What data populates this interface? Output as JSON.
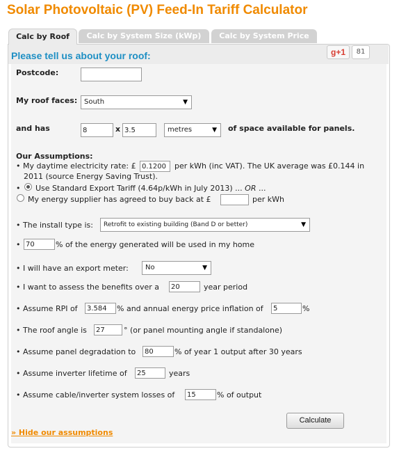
{
  "page": {
    "title": "Solar Photovoltaic (PV) Feed-In Tariff Calculator"
  },
  "tabs": [
    {
      "label": "Calc by Roof",
      "active": true
    },
    {
      "label": "Calc by System Size (kWp)",
      "active": false
    },
    {
      "label": "Calc by System Price",
      "active": false
    }
  ],
  "panel": {
    "heading": "Please tell us about your roof:"
  },
  "social": {
    "gplus_label": "g+1",
    "gplus_count": "81"
  },
  "roof": {
    "postcode_label": "Postcode:",
    "postcode_value": "",
    "faces_label": "My roof faces:",
    "faces_value": "South",
    "and_has_label": "and has",
    "dim_a": "8",
    "times": "x",
    "dim_b": "3.5",
    "unit_value": "metres",
    "space_suffix": "of space available for panels."
  },
  "assumptions": {
    "heading": "Our Assumptions:",
    "daytime_prefix": "My daytime electricity rate: £",
    "daytime_value": "0.1200",
    "daytime_suffix_1": "per kWh (inc VAT). The UK average was £0.144 in",
    "daytime_suffix_2": "2011 (source Energy Saving Trust).",
    "export_option_1_pre": "Use Standard Export Tariff (4.64p/kWh in July 2013) ... ",
    "export_option_1_or": "OR",
    "export_option_1_post": " ...",
    "export_option_2_prefix": "My energy supplier has agreed to buy back at £",
    "export_option_2_value": "",
    "export_option_2_suffix": "per kWh",
    "install_label": "The install type is:",
    "install_value": "Retrofit to existing building (Band D or better)",
    "used_value": "70",
    "used_suffix": "% of the energy generated will be used in my home",
    "meter_label": "I will have an export meter:",
    "meter_value": "No",
    "period_prefix": "I want to assess the benefits over a",
    "period_value": "20",
    "period_suffix": "year period",
    "rpi_prefix": "Assume RPI of",
    "rpi_value": "3.584",
    "rpi_mid": "% and annual energy price inflation of",
    "inflation_value": "5",
    "inflation_suffix": "%",
    "angle_prefix": "The roof angle is",
    "angle_value": "27",
    "angle_suffix": "° (or panel mounting angle if standalone)",
    "degradation_prefix": "Assume panel degradation to",
    "degradation_value": "80",
    "degradation_suffix": "% of year 1 output after 30 years",
    "inverter_prefix": "Assume inverter lifetime of",
    "inverter_value": "25",
    "inverter_suffix": "years",
    "losses_prefix": "Assume cable/inverter system losses of",
    "losses_value": "15",
    "losses_suffix": "% of output"
  },
  "actions": {
    "calculate_label": "Calculate",
    "hide_link": "» Hide our assumptions"
  },
  "colors": {
    "title": "#f08a00",
    "heading": "#1e8fc4",
    "link": "#f08a00"
  }
}
